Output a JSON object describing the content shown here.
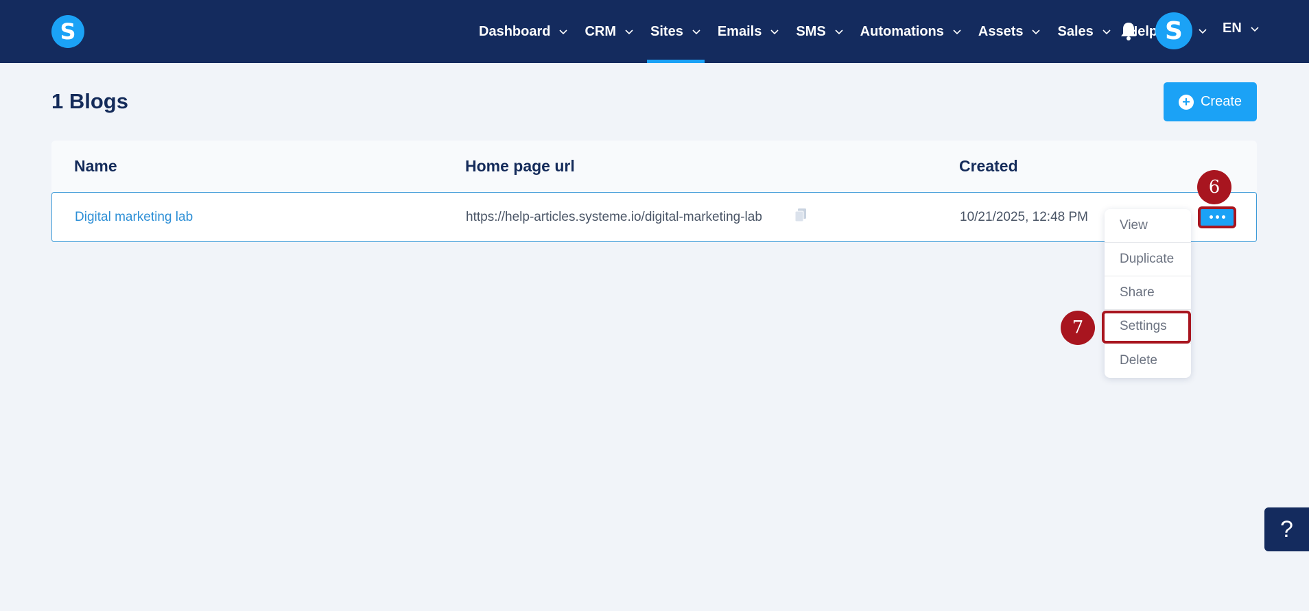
{
  "header": {
    "logo_letter": "S",
    "nav": [
      {
        "label": "Dashboard",
        "dropdown": true,
        "active": false
      },
      {
        "label": "CRM",
        "dropdown": true,
        "active": false
      },
      {
        "label": "Sites",
        "dropdown": true,
        "active": true
      },
      {
        "label": "Emails",
        "dropdown": true,
        "active": false
      },
      {
        "label": "SMS",
        "dropdown": true,
        "active": false
      },
      {
        "label": "Automations",
        "dropdown": true,
        "active": false
      },
      {
        "label": "Assets",
        "dropdown": true,
        "active": false
      },
      {
        "label": "Sales",
        "dropdown": true,
        "active": false
      },
      {
        "label": "Help",
        "dropdown": false,
        "active": false
      }
    ],
    "bell_icon": "bell-icon",
    "avatar_letter": "S",
    "language": "EN"
  },
  "page": {
    "title": "1 Blogs",
    "create_label": "Create"
  },
  "table": {
    "columns": [
      "Name",
      "Home page url",
      "Created"
    ],
    "rows": [
      {
        "name": "Digital marketing lab",
        "url": "https://help-articles.systeme.io/digital-marketing-lab",
        "created": "10/21/2025, 12:48 PM"
      }
    ]
  },
  "menu": {
    "items": [
      "View",
      "Duplicate",
      "Share",
      "Settings",
      "Delete"
    ]
  },
  "steps": {
    "more_button_step": "6",
    "settings_step": "7"
  },
  "help_fab": "?",
  "colors": {
    "nav_bg": "#142b5e",
    "accent": "#1ba2f6",
    "highlight": "#a8151f",
    "page_bg": "#f1f4f9"
  }
}
